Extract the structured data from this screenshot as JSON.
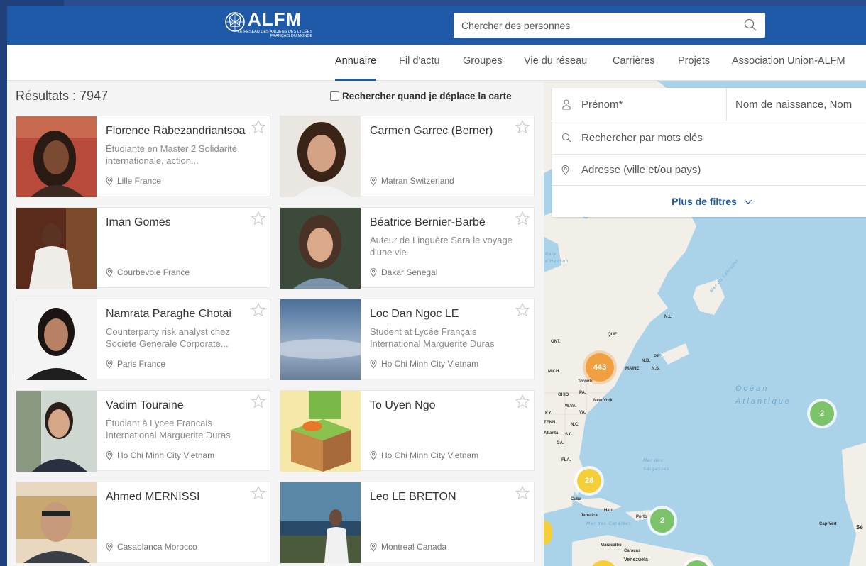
{
  "header": {
    "logo_text": "ALFM",
    "logo_subtitle": "LE RÉSEAU DES ANCIENS DES LYCÉES FRANÇAIS DU MONDE",
    "search_placeholder": "Chercher des personnes"
  },
  "nav": {
    "items": [
      "Annuaire",
      "Fil d'actu",
      "Groupes",
      "Vie du réseau",
      "Carrières",
      "Projets",
      "Association Union-ALFM"
    ],
    "active": "Annuaire"
  },
  "results": {
    "count_label": "Résultats : 7947",
    "map_toggle_label": "Rechercher quand je déplace la carte"
  },
  "people": [
    {
      "name": "Florence Rabezandriantsoa",
      "desc": "Étudiante en Master 2 Solidarité internationale, action...",
      "location": "Lille France"
    },
    {
      "name": "Carmen Garrec (Berner)",
      "desc": "",
      "location": "Matran Switzerland"
    },
    {
      "name": "Iman Gomes",
      "desc": "",
      "location": "Courbevoie France"
    },
    {
      "name": "Béatrice Bernier-Barbé",
      "desc": "Auteur de Linguère Sara le voyage d'une vie",
      "location": "Dakar Senegal"
    },
    {
      "name": "Namrata Paraghe Chotai",
      "desc": "Counterparty risk analyst chez Societe Generale Corporate...",
      "location": "Paris France"
    },
    {
      "name": "Loc Dan Ngoc LE",
      "desc": "Student at Lycée Français International Marguerite Duras",
      "location": "Ho Chi Minh City Vietnam"
    },
    {
      "name": "Vadim Touraine",
      "desc": "Étudiant à Lycee Francais International Marguerite Duras",
      "location": "Ho Chi Minh City Vietnam"
    },
    {
      "name": "To Uyen Ngo",
      "desc": "",
      "location": "Ho Chi Minh City Vietnam"
    },
    {
      "name": "Ahmed MERNISSI",
      "desc": "",
      "location": "Casablanca Morocco"
    },
    {
      "name": "Leo LE BRETON",
      "desc": "",
      "location": "Montreal Canada"
    }
  ],
  "filters": {
    "first_name_placeholder": "Prénom*",
    "last_name_placeholder": "Nom de naissance, Nom",
    "keywords_placeholder": "Rechercher par mots clés",
    "address_placeholder": "Adresse (ville et/ou pays)",
    "more_filters_label": "Plus de filtres"
  },
  "map": {
    "clusters": [
      {
        "count": "443",
        "color": "#f0a040"
      },
      {
        "count": "2",
        "color": "#7cc36a"
      },
      {
        "count": "28",
        "color": "#f5cf3a"
      },
      {
        "count": "2",
        "color": "#7cc36a"
      }
    ],
    "labels": {
      "ocean": "Océan Atlantique",
      "sargasso": "Mer des Sargasses",
      "caribbean": "Mer des Caraïbes",
      "labrador": "Mer du Labrador",
      "baie": "Baie d'Hudson",
      "ont": "ONT.",
      "que": "QUE.",
      "nl": "N.L.",
      "maine": "MAINE",
      "nb": "N.B.",
      "pei": "P.E.I.",
      "ns": "N.S.",
      "mich": "MICH.",
      "ohio": "OHIO",
      "pa": "PA.",
      "ny": "New York",
      "wva": "W.VA.",
      "va": "VA.",
      "ky": "KY.",
      "tenn": "TENN.",
      "nc": "N.C.",
      "sc": "S.C.",
      "ga": "GA.",
      "atlanta": "Atlanta",
      "fla": "FLA.",
      "toronto": "Toronto",
      "cuba": "Cuba",
      "jamaica": "Jamaica",
      "haiti": "Haiti",
      "pr": "Porto Rico",
      "maracaibo": "Maracaibo",
      "caracas": "Caracas",
      "venezuela": "Venezuela",
      "capvert": "Cap-Vert",
      "se": "Sé"
    }
  }
}
